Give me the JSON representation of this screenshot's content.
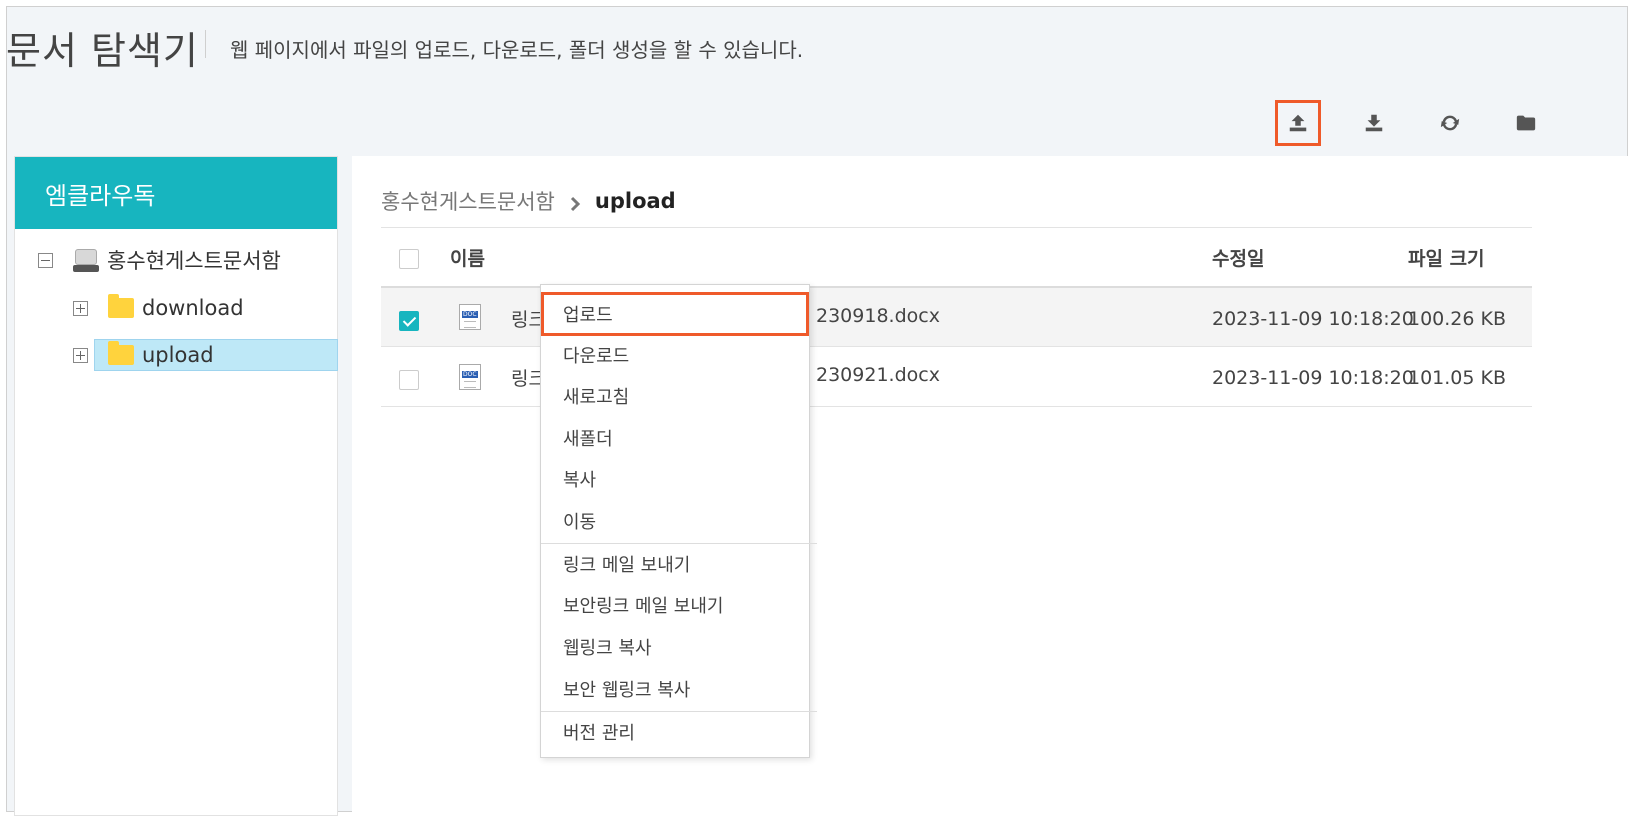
{
  "header": {
    "title": "문서 탐색기",
    "subtitle": "웹 페이지에서 파일의 업로드, 다운로드, 폴더 생성을 할 수 있습니다."
  },
  "toolbar": {
    "icons": [
      "upload-icon",
      "download-icon",
      "refresh-icon",
      "folder-icon"
    ],
    "highlight_color": "#ef5a2a"
  },
  "sidebar": {
    "header": "엠클라우독",
    "header_color": "#17b5bf",
    "tree": {
      "root": "홍수현게스트문서함",
      "children": [
        "download",
        "upload"
      ],
      "selected": "upload"
    }
  },
  "breadcrumb": {
    "parent": "홍수현게스트문서함",
    "current": "upload"
  },
  "table": {
    "columns": {
      "name": "이름",
      "modified": "수정일",
      "size": "파일 크기"
    },
    "rows": [
      {
        "name_prefix": "링크",
        "name_suffix": "230918.docx",
        "modified": "2023-11-09 10:18:20",
        "size": "100.26 KB",
        "checked": true
      },
      {
        "name_prefix": "링크",
        "name_suffix": "230921.docx",
        "modified": "2023-11-09 10:18:20",
        "size": "101.05 KB",
        "checked": false
      }
    ]
  },
  "context_menu": {
    "items": [
      "업로드",
      "다운로드",
      "새로고침",
      "새폴더",
      "복사",
      "이동",
      "링크 메일 보내기",
      "보안링크 메일 보내기",
      "웹링크 복사",
      "보안 웹링크 복사",
      "버전 관리"
    ],
    "highlighted": "업로드"
  }
}
